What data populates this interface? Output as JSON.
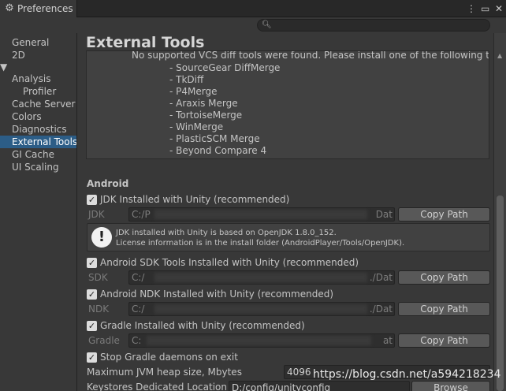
{
  "window": {
    "tab_title": "Preferences",
    "icons": [
      "gear-icon",
      "more-icon",
      "maximize-icon",
      "close-icon"
    ]
  },
  "search": {
    "placeholder": ""
  },
  "sidebar": {
    "items": [
      {
        "label": "General"
      },
      {
        "label": "2D"
      },
      {
        "label": "Analysis"
      },
      {
        "label": "Profiler"
      },
      {
        "label": "Cache Server ("
      },
      {
        "label": "Colors"
      },
      {
        "label": "Diagnostics"
      },
      {
        "label": "External Tools"
      },
      {
        "label": "GI Cache"
      },
      {
        "label": "UI Scaling"
      }
    ]
  },
  "main": {
    "title": "External Tools",
    "vcs": {
      "header": "No supported VCS diff tools were found. Please install one of the following tools:",
      "tools": [
        "- SourceGear DiffMerge",
        "- TkDiff",
        "- P4Merge",
        "- Araxis Merge",
        "- TortoiseMerge",
        "- WinMerge",
        "- PlasticSCM Merge",
        "- Beyond Compare 4"
      ]
    },
    "android": {
      "section_label": "Android",
      "jdk": {
        "check_label": "JDK Installed with Unity (recommended)",
        "path_label": "JDK",
        "path_value": "C:/P",
        "path_tail": "Dat",
        "button": "Copy Path"
      },
      "help": {
        "line1": "JDK installed with Unity is based on OpenJDK 1.8.0_152.",
        "line2": "License information is in the install folder (AndroidPlayer/Tools/OpenJDK)."
      },
      "sdk": {
        "check_label": "Android SDK Tools Installed with Unity (recommended)",
        "path_label": "SDK",
        "path_value": "C:/",
        "path_tail": "./Dat",
        "button": "Copy Path"
      },
      "ndk": {
        "check_label": "Android NDK Installed with Unity (recommended)",
        "path_label": "NDK",
        "path_value": "C:/",
        "path_tail": "./Dat",
        "button": "Copy Path"
      },
      "gradle": {
        "check_label": "Gradle Installed with Unity (recommended)",
        "path_label": "Gradle",
        "path_value": "C:",
        "path_tail": "at",
        "button": "Copy Path"
      },
      "daemons": {
        "check_label": "Stop Gradle daemons on exit"
      },
      "heap": {
        "label": "Maximum JVM heap size, Mbytes",
        "value": "4096"
      },
      "keystores": {
        "label": "Keystores Dedicated Location",
        "value": "D:/config/unityconfig",
        "button": "Browse"
      }
    }
  },
  "watermark": "https://blog.csdn.net/a594218234"
}
